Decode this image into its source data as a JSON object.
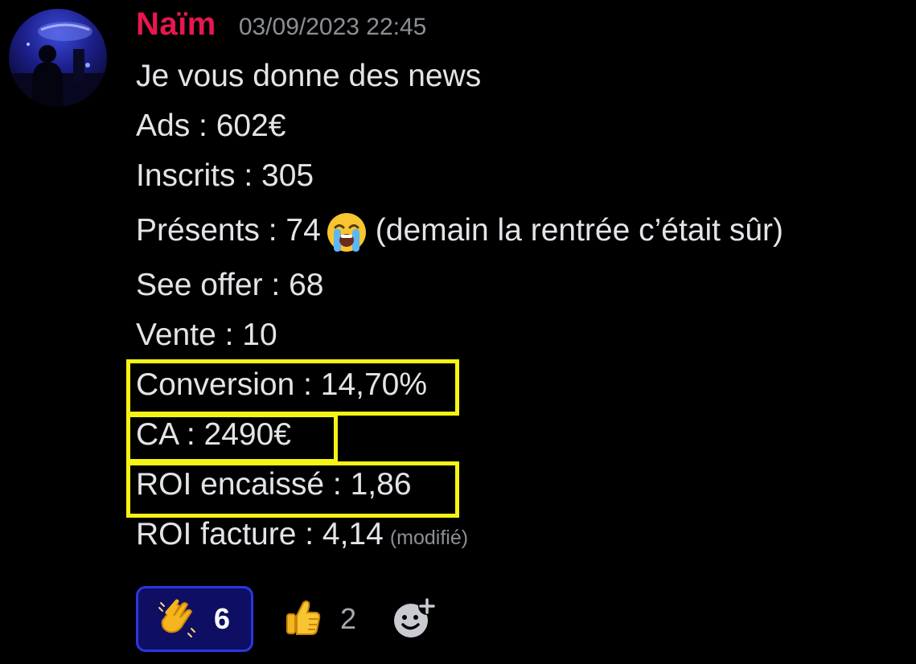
{
  "message": {
    "author": "Naïm",
    "timestamp": "03/09/2023 22:45",
    "lines": [
      "Je vous donne des news",
      "Ads : 602€",
      "Inscrits : 305"
    ],
    "presents": {
      "prefix": "Présents : 74",
      "emoji": "loudly-crying-face-icon",
      "suffix": "(demain la rentrée c’était sûr)"
    },
    "lines2": [
      "See offer : 68",
      "Vente : 10"
    ],
    "highlighted_lines": [
      "Conversion : 14,70%",
      "CA : 2490€",
      "ROI encaissé : 1,86"
    ],
    "last_line": "ROI facture : 4,14",
    "edited_label": "(modifié)",
    "highlight_color": "#f4f415",
    "author_color": "#e8174f"
  },
  "reactions": [
    {
      "emoji": "clapping-hands-icon",
      "count": "6",
      "active": true
    },
    {
      "emoji": "thumbs-up-icon",
      "count": "2",
      "active": false
    }
  ],
  "add_reaction_icon": "add-reaction-icon"
}
